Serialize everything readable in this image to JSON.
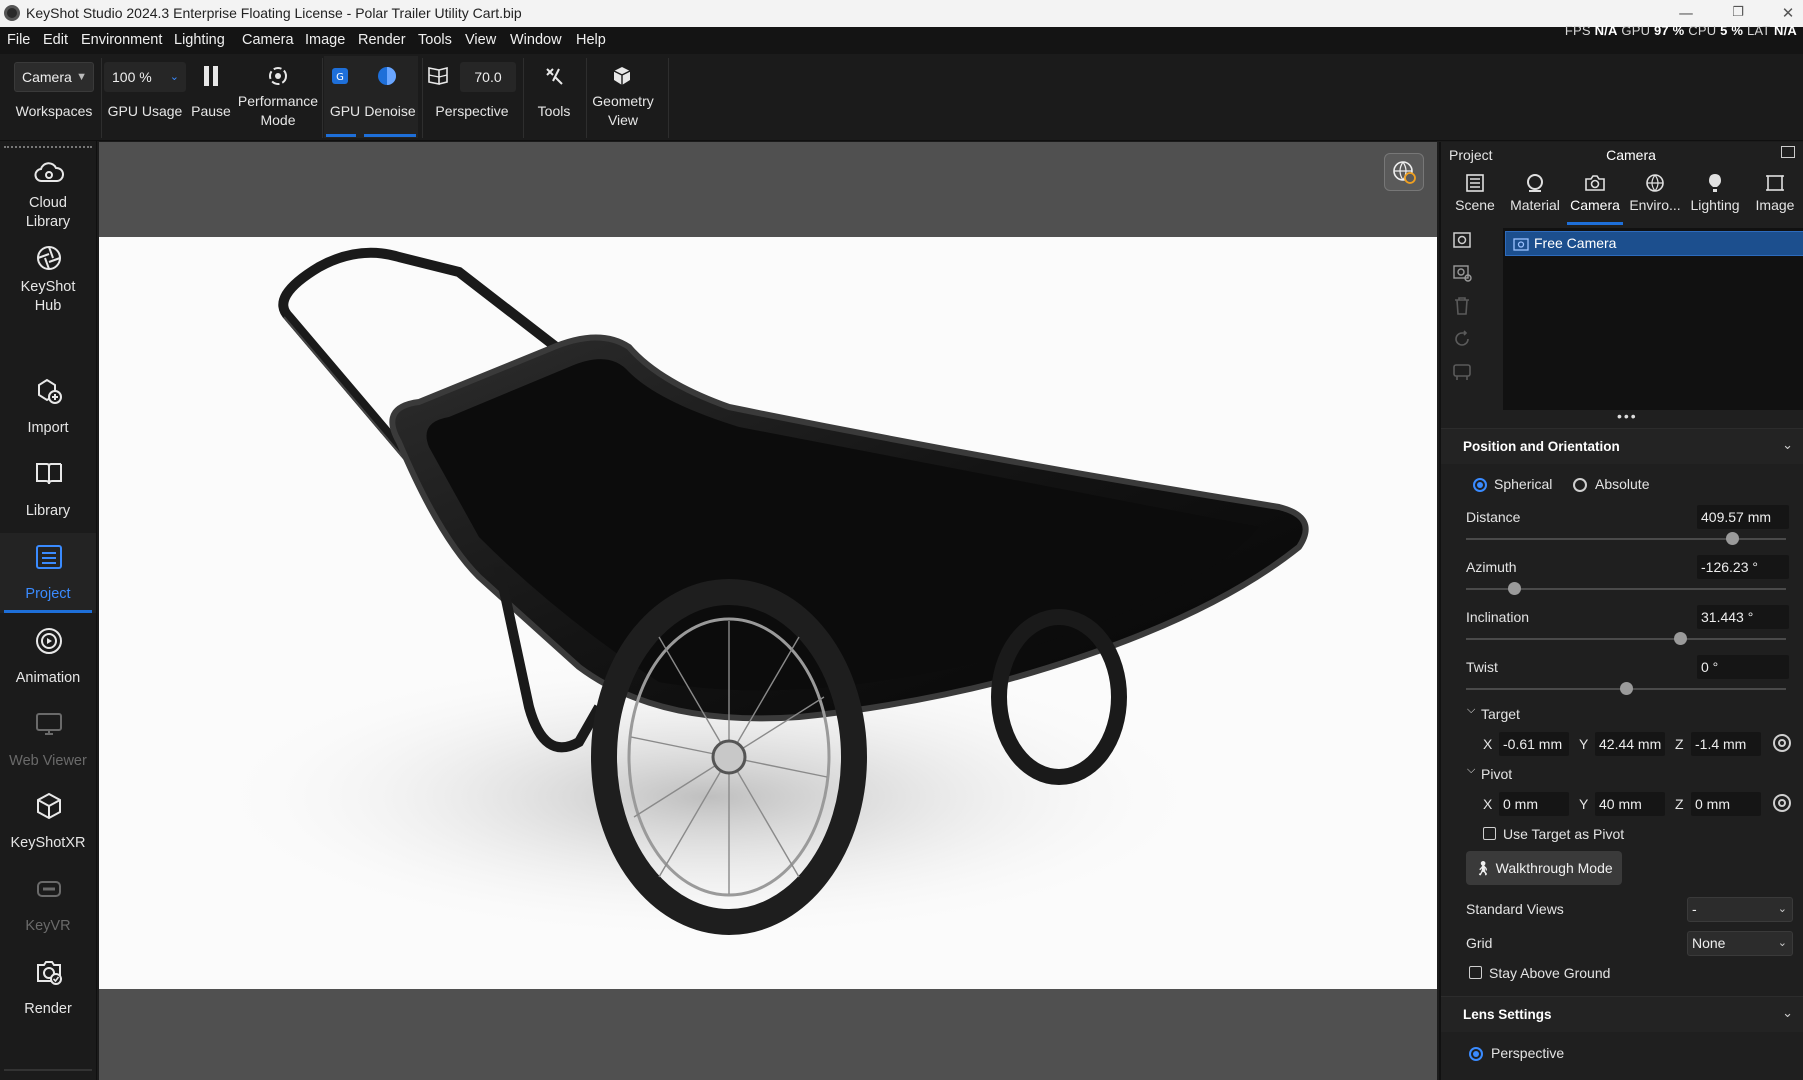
{
  "window": {
    "title": "KeyShot Studio 2024.3 Enterprise Floating License  - Polar Trailer Utility Cart.bip",
    "minimize": "—",
    "restore": "❐",
    "close": "✕"
  },
  "menu": [
    "File",
    "Edit",
    "Environment",
    "Lighting",
    "Camera",
    "Image",
    "Render",
    "Tools",
    "View",
    "Window",
    "Help"
  ],
  "stats": {
    "fps_label": "FPS",
    "fps_value": "N/A",
    "gpu_label": "GPU",
    "gpu_value": "97 %",
    "cpu_label": "CPU",
    "cpu_value": "5 %",
    "lat_label": "LAT",
    "lat_value": "N/A"
  },
  "toolbar": {
    "workspace_value": "Camera",
    "workspaces_label": "Workspaces",
    "gpu_usage_value": "100 %",
    "gpu_usage_label": "GPU Usage",
    "pause_label": "Pause",
    "performance_label_1": "Performance",
    "performance_label_2": "Mode",
    "gpu_label": "GPU",
    "denoise_label": "Denoise",
    "fov_value": "70.0",
    "perspective_label": "Perspective",
    "tools_label": "Tools",
    "geometry_label_1": "Geometry",
    "geometry_label_2": "View"
  },
  "sidebar": {
    "items": [
      {
        "name": "cloud-library",
        "line1": "Cloud",
        "line2": "Library",
        "icon": "cloud-gear-icon"
      },
      {
        "name": "keyshot-hub",
        "line1": "KeyShot",
        "line2": "Hub",
        "icon": "aperture-icon"
      },
      {
        "name": "import",
        "line1": "Import",
        "line2": "",
        "icon": "import-plus-icon"
      },
      {
        "name": "library",
        "line1": "Library",
        "line2": "",
        "icon": "book-icon"
      },
      {
        "name": "project",
        "line1": "Project",
        "line2": "",
        "icon": "list-icon",
        "active": true
      },
      {
        "name": "animation",
        "line1": "Animation",
        "line2": "",
        "icon": "play-circle-icon"
      },
      {
        "name": "web-viewer",
        "line1": "Web Viewer",
        "line2": "",
        "icon": "monitor-icon",
        "dim": true
      },
      {
        "name": "keyshotxr",
        "line1": "KeyShotXR",
        "line2": "",
        "icon": "cube-icon"
      },
      {
        "name": "keyvr",
        "line1": "KeyVR",
        "line2": "",
        "icon": "vr-headset-icon",
        "dim": true
      },
      {
        "name": "render",
        "line1": "Render",
        "line2": "",
        "icon": "render-check-icon"
      }
    ]
  },
  "panel": {
    "header_left": "Project",
    "header_title": "Camera",
    "tabs": [
      {
        "label": "Scene",
        "icon": "scene-list-icon"
      },
      {
        "label": "Material",
        "icon": "material-ball-icon"
      },
      {
        "label": "Camera",
        "icon": "camera-icon",
        "active": true
      },
      {
        "label": "Enviro...",
        "icon": "globe-icon"
      },
      {
        "label": "Lighting",
        "icon": "bulb-icon"
      },
      {
        "label": "Image",
        "icon": "image-crop-icon"
      }
    ],
    "camera_list": [
      "Free Camera"
    ],
    "more": "•••",
    "position_section": "Position and Orientation",
    "mode_spherical": "Spherical",
    "mode_absolute": "Absolute",
    "distance_label": "Distance",
    "distance_value": "409.57 mm",
    "distance_fraction": 0.83,
    "azimuth_label": "Azimuth",
    "azimuth_value": "-126.23 °",
    "azimuth_fraction": 0.15,
    "inclination_label": "Inclination",
    "inclination_value": "31.443 °",
    "inclination_fraction": 0.67,
    "twist_label": "Twist",
    "twist_value": "0 °",
    "twist_fraction": 0.5,
    "target_label": "Target",
    "target_x": "-0.61 mm",
    "target_y": "42.44 mm",
    "target_z": "-1.4 mm",
    "pivot_label": "Pivot",
    "pivot_x": "0 mm",
    "pivot_y": "40 mm",
    "pivot_z": "0 mm",
    "x_label": "X",
    "y_label": "Y",
    "z_label": "Z",
    "use_target_pivot": "Use Target as Pivot",
    "walkthrough": "Walkthrough Mode",
    "standard_views_label": "Standard Views",
    "standard_views_value": "-",
    "grid_label": "Grid",
    "grid_value": "None",
    "stay_above_ground": "Stay Above Ground",
    "lens_section": "Lens Settings",
    "lens_perspective": "Perspective"
  }
}
